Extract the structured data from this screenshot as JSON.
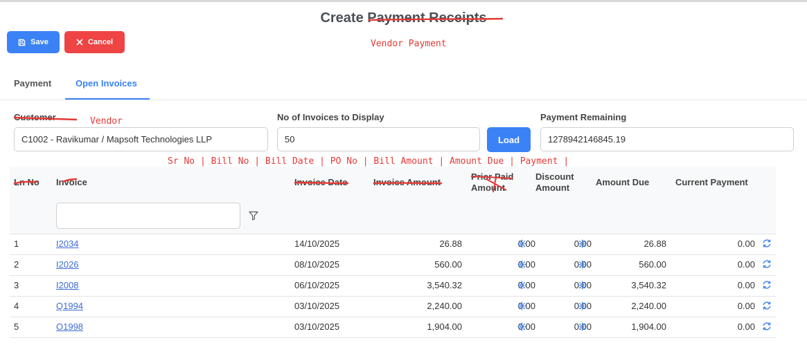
{
  "page": {
    "title": "Create Payment Receipts"
  },
  "toolbar": {
    "save_label": "Save",
    "cancel_label": "Cancel"
  },
  "annotations": {
    "title_note": "Vendor Payment",
    "customer_note": "Vendor",
    "columns_note": "Sr No | Bill No | Bill Date | PO No | Bill Amount | Amount Due | Payment |"
  },
  "tabs": [
    {
      "label": "Payment",
      "active": false
    },
    {
      "label": "Open Invoices",
      "active": true
    }
  ],
  "form": {
    "customer_label": "Customer",
    "customer_value": "C1002 - Ravikumar / Mapsoft Technologies LLP",
    "num_invoices_label": "No of Invoices to Display",
    "num_invoices_value": "50",
    "load_label": "Load",
    "payment_remaining_label": "Payment Remaining",
    "payment_remaining_value": "1278942146845.19"
  },
  "table": {
    "headers": {
      "ln_no": "Ln No",
      "invoice": "Invoice",
      "invoice_date": "Invoice Date",
      "invoice_amount": "Invoice Amount",
      "prior_paid_1": "Prior Paid",
      "prior_paid_2": "Amount",
      "discount_1": "Discount",
      "discount_2": "Amount",
      "amount_due": "Amount Due",
      "current_payment": "Current Payment"
    },
    "rows": [
      {
        "ln": "1",
        "invoice": "I2034",
        "date": "14/10/2025",
        "amount": "26.88",
        "prior": "0.00",
        "discount": "0.00",
        "due": "26.88",
        "current": "0.00"
      },
      {
        "ln": "2",
        "invoice": "I2026",
        "date": "08/10/2025",
        "amount": "560.00",
        "prior": "0.00",
        "discount": "0.00",
        "due": "560.00",
        "current": "0.00"
      },
      {
        "ln": "3",
        "invoice": "I2008",
        "date": "06/10/2025",
        "amount": "3,540.32",
        "prior": "0.00",
        "discount": "0.00",
        "due": "3,540.32",
        "current": "0.00"
      },
      {
        "ln": "4",
        "invoice": "Q1994",
        "date": "03/10/2025",
        "amount": "2,240.00",
        "prior": "0.00",
        "discount": "0.00",
        "due": "2,240.00",
        "current": "0.00"
      },
      {
        "ln": "5",
        "invoice": "O1998",
        "date": "03/10/2025",
        "amount": "1,904.00",
        "prior": "0.00",
        "discount": "0.00",
        "due": "1,904.00",
        "current": "0.00"
      }
    ]
  },
  "icons": {
    "save": "save-icon",
    "cancel": "close-icon",
    "filter": "filter-icon",
    "gear": "gear-icon",
    "refresh": "refresh-icon"
  },
  "colors": {
    "primary": "#3b82f6",
    "danger": "#ef4444",
    "annotation": "#e53935",
    "link": "#3b6bd6"
  }
}
